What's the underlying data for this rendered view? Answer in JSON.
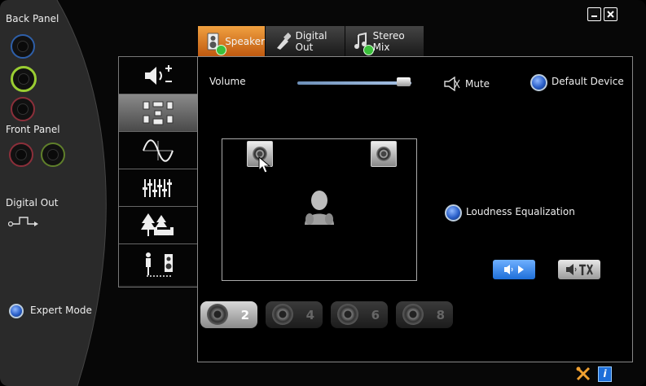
{
  "left": {
    "back_panel_label": "Back Panel",
    "front_panel_label": "Front Panel",
    "digital_out_label": "Digital Out",
    "expert_mode_label": "Expert Mode"
  },
  "tabs": [
    {
      "label": "Speaker",
      "active": true,
      "icon": "speaker-tab-icon"
    },
    {
      "label": "Digital Out",
      "active": false,
      "icon": "digital-out-plug-icon"
    },
    {
      "label": "Stereo Mix",
      "active": false,
      "icon": "music-note-icon"
    }
  ],
  "controls": {
    "volume_label": "Volume",
    "volume_level": 0.93,
    "mute_label": "Mute",
    "default_device_label": "Default Device",
    "loudness_label": "Loudness Equalization"
  },
  "channels": [
    "2",
    "4",
    "6",
    "8"
  ],
  "colors": {
    "accent_blue": "#3a7bd5",
    "active_tab": "#e07a1a",
    "jack_green": "#9acd32",
    "jack_red": "#8b2f3a",
    "jack_blue": "#2e5fa8"
  }
}
